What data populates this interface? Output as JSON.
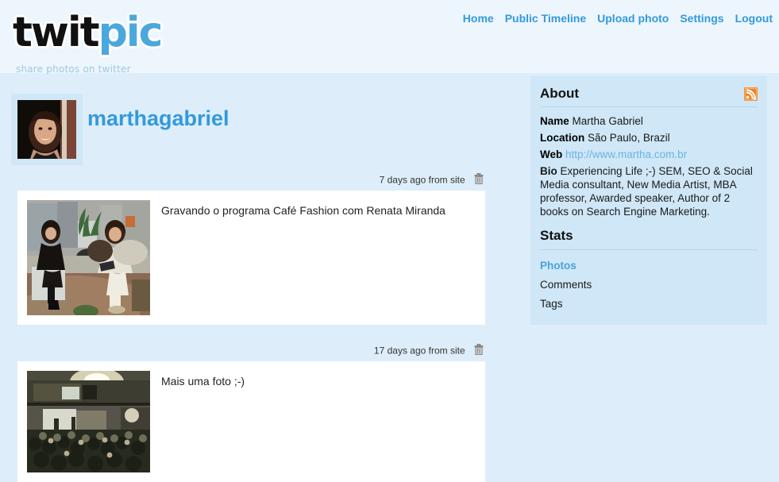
{
  "site": {
    "logo_part1": "twit",
    "logo_part2": "pic",
    "tagline": "share photos on twitter"
  },
  "nav": {
    "items": [
      {
        "label": "Home",
        "name": "nav-home"
      },
      {
        "label": "Public Timeline",
        "name": "nav-public-timeline"
      },
      {
        "label": "Upload photo",
        "name": "nav-upload-photo"
      },
      {
        "label": "Settings",
        "name": "nav-settings"
      },
      {
        "label": "Logout",
        "name": "nav-logout"
      }
    ]
  },
  "profile": {
    "username": "marthagabriel",
    "avatar_alt": "avatar"
  },
  "posts": [
    {
      "timestamp": "7 days ago from site",
      "caption": "Gravando o programa Café Fashion com Renata Miranda",
      "delete_icon": "trash-icon"
    },
    {
      "timestamp": "17 days ago from site",
      "caption": "Mais uma foto ;-)",
      "delete_icon": "trash-icon"
    }
  ],
  "sidebar": {
    "about_title": "About",
    "rss_icon": "rss-icon",
    "name_label": "Name",
    "name_value": "Martha Gabriel",
    "location_label": "Location",
    "location_value": "São Paulo, Brazil",
    "web_label": "Web",
    "web_value": "http://www.martha.com.br",
    "bio_label": "Bio",
    "bio_value": "Experiencing Life ;-) SEM, SEO & Social Media consultant, New Media Artist, MBA professor, Awarded speaker, Author of 2 books on Search Engine Marketing.",
    "stats_title": "Stats",
    "stats": [
      {
        "label": "Photos",
        "active": true
      },
      {
        "label": "Comments",
        "active": false
      },
      {
        "label": "Tags",
        "active": false
      }
    ]
  },
  "colors": {
    "page_bg": "#ddeefa",
    "header_bg": "#edf6fd",
    "accent_blue": "#3399dd",
    "sidebar_bg": "#cfe7f7",
    "link_blue": "#69b4e2",
    "rss_orange": "#f08020",
    "card_bg": "#ffffff"
  }
}
